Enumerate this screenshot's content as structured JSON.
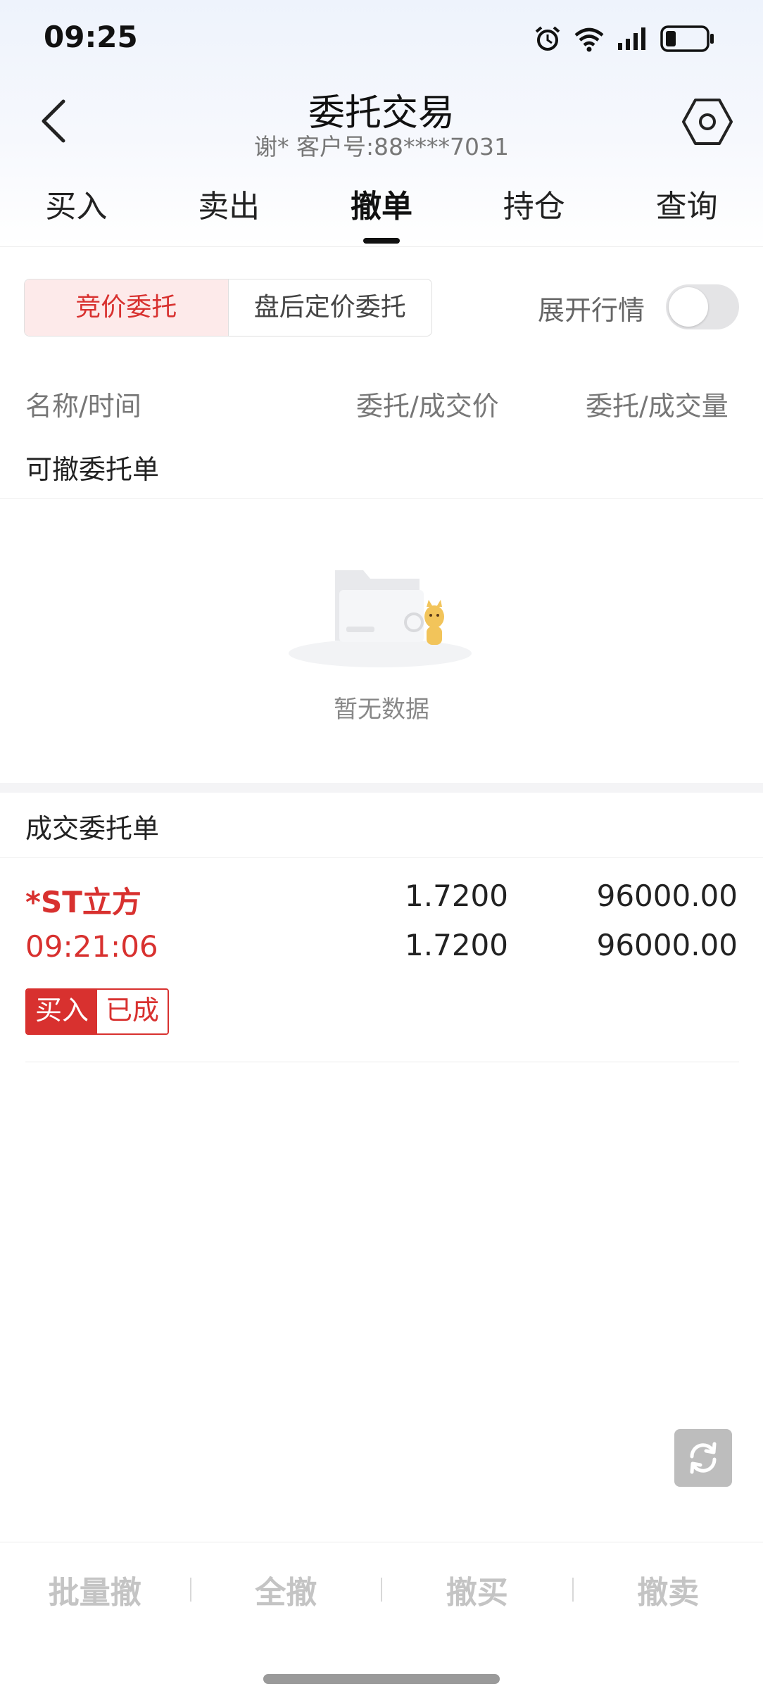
{
  "status_bar": {
    "time": "09:25"
  },
  "header": {
    "title": "委托交易",
    "subtitle": "谢* 客户号:88****7031"
  },
  "tabs": [
    {
      "label": "买入"
    },
    {
      "label": "卖出"
    },
    {
      "label": "撤单",
      "active": true
    },
    {
      "label": "持仓"
    },
    {
      "label": "查询"
    }
  ],
  "segment": {
    "options": [
      "竞价委托",
      "盘后定价委托"
    ],
    "selected": "竞价委托"
  },
  "expand_toggle": {
    "label": "展开行情",
    "on": false
  },
  "columns": [
    "名称/时间",
    "委托/成交价",
    "委托/成交量"
  ],
  "cancellable": {
    "title": "可撤委托单",
    "empty_text": "暂无数据"
  },
  "filled": {
    "title": "成交委托单",
    "rows": [
      {
        "name": "*ST立方",
        "time": "09:21:06",
        "order_price": "1.7200",
        "deal_price": "1.7200",
        "order_qty": "96000.00",
        "deal_qty": "96000.00",
        "side": "买入",
        "status": "已成"
      }
    ]
  },
  "bottom_actions": [
    "批量撤",
    "全撤",
    "撤买",
    "撤卖"
  ],
  "colors": {
    "accent_red": "#d8312f",
    "disabled_gray": "#c4c4c4"
  }
}
